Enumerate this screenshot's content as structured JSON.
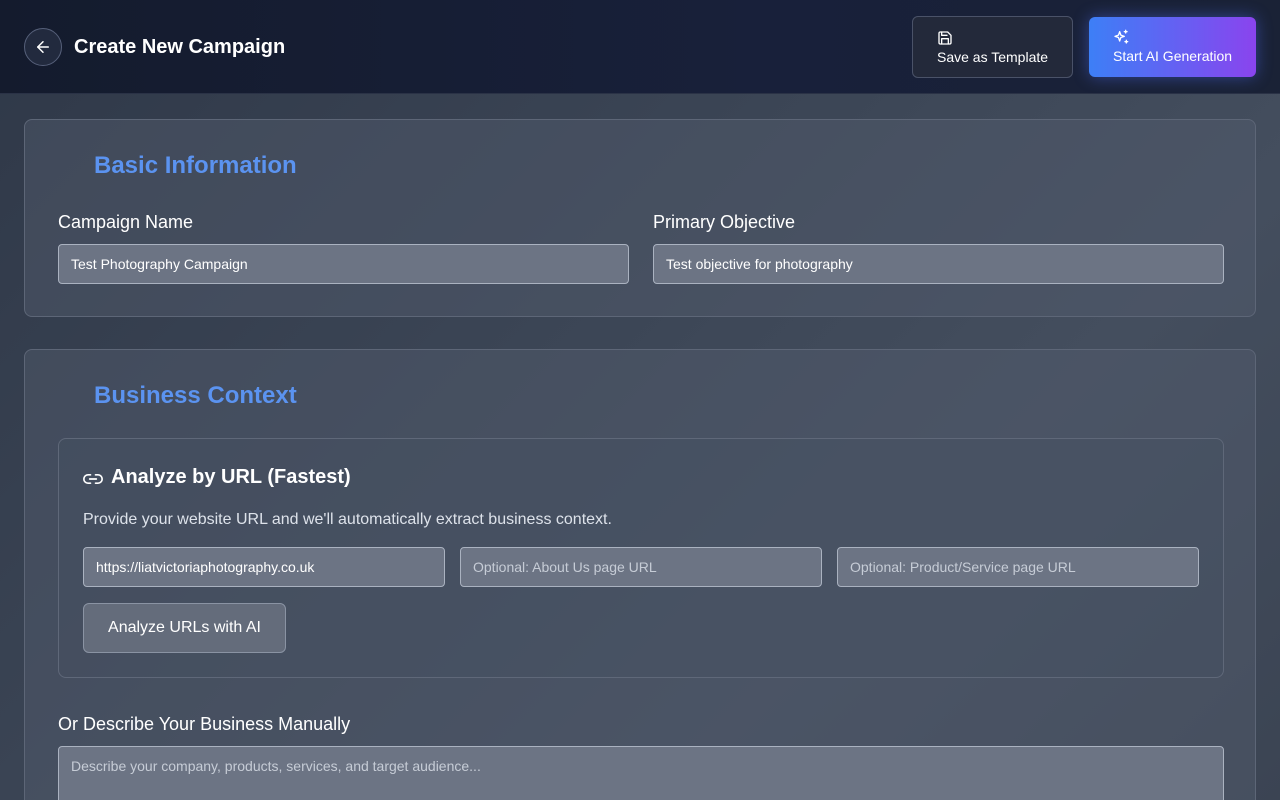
{
  "header": {
    "title": "Create New Campaign",
    "back_icon": "arrow-left-icon",
    "save_template_label": "Save as Template",
    "save_template_icon": "floppy-disk-icon",
    "start_ai_label": "Start AI Generation",
    "start_ai_icon": "sparkles-icon",
    "accent_gradient": [
      "#3d7ff6",
      "#8a44ee"
    ]
  },
  "basic_info": {
    "title": "Basic Information",
    "title_color": "#5b93f0",
    "campaign_name_label": "Campaign Name",
    "campaign_name_value": "Test Photography Campaign",
    "primary_objective_label": "Primary Objective",
    "primary_objective_value": "Test objective for photography"
  },
  "business_context": {
    "title": "Business Context",
    "analyze": {
      "icon": "link-icon",
      "title": "Analyze by URL (Fastest)",
      "description": "Provide your website URL and we'll automatically extract business context.",
      "website_url_value": "https://liatvictoriaphotography.co.uk",
      "about_url_placeholder": "Optional: About Us page URL",
      "product_url_placeholder": "Optional: Product/Service page URL",
      "button_label": "Analyze URLs with AI"
    },
    "manual_label": "Or Describe Your Business Manually",
    "manual_placeholder": "Describe your company, products, services, and target audience..."
  }
}
